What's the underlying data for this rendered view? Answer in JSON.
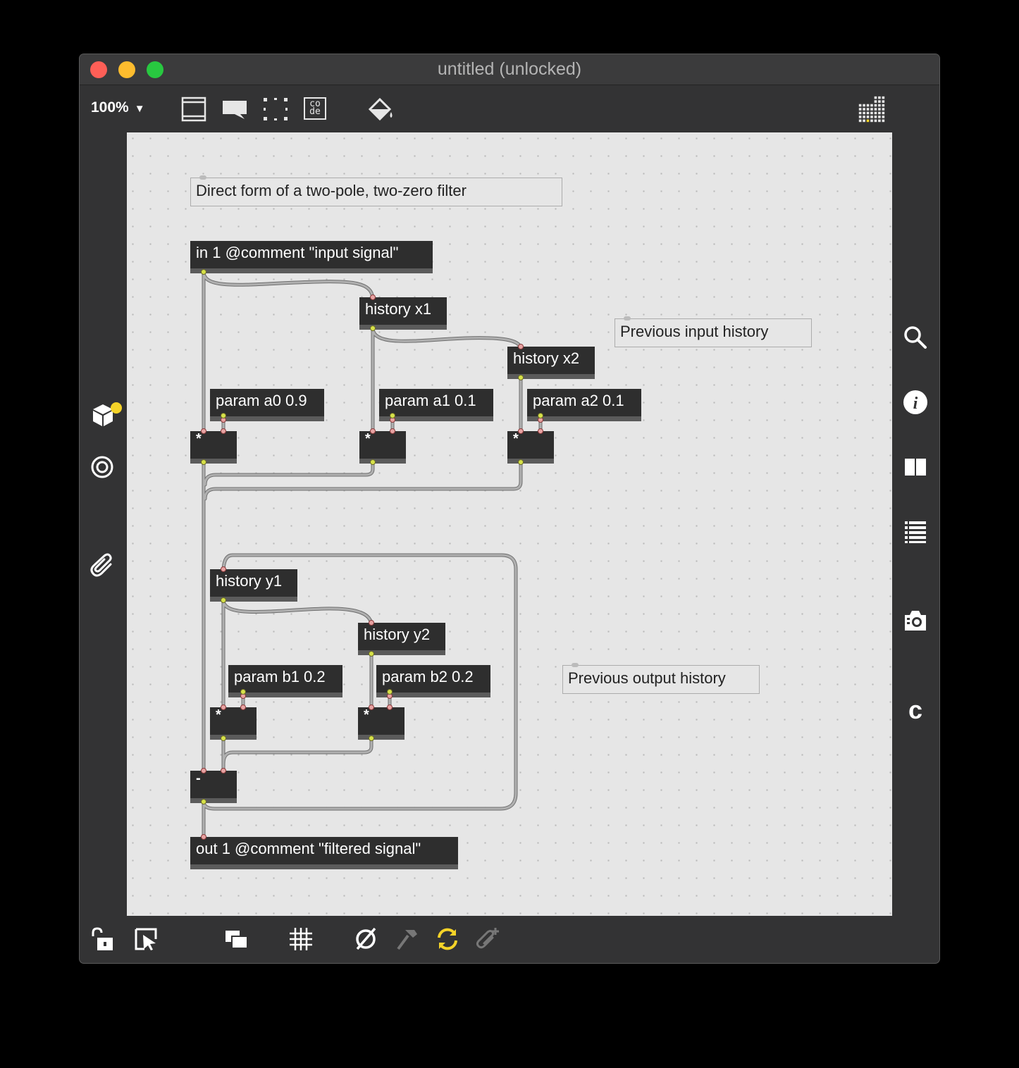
{
  "window": {
    "title": "untitled (unlocked)"
  },
  "toolbar": {
    "zoom_label": "100%",
    "icons": [
      "presentation-icon",
      "comment-icon",
      "object-box-icon",
      "code-icon",
      "paint-bucket-icon",
      "grid-view-icon"
    ],
    "code_icon_text": "co de"
  },
  "left_sidebar": {
    "icons": [
      "package-icon",
      "target-icon",
      "paperclip-icon"
    ]
  },
  "right_sidebar": {
    "icons": [
      "search-icon",
      "info-icon",
      "columns-icon",
      "list-icon",
      "camera-icon",
      "clipping-icon"
    ]
  },
  "bottom_bar": {
    "icons": [
      "lock-icon",
      "presentation-select-icon",
      "layers-icon",
      "grid-icon",
      "mute-icon",
      "hammer-icon",
      "refresh-icon",
      "add-clip-icon"
    ]
  },
  "patch": {
    "comments": {
      "title": "Direct form of a two-pole, two-zero filter",
      "input_history": "Previous input history",
      "output_history": "Previous output history"
    },
    "objects": {
      "in1": "in 1 @comment \"input signal\"",
      "history_x1": "history x1",
      "history_x2": "history x2",
      "param_a0": "param a0 0.9",
      "param_a1": "param a1 0.1",
      "param_a2": "param a2 0.1",
      "mul_a0": "*",
      "mul_a1": "*",
      "mul_a2": "*",
      "history_y1": "history y1",
      "history_y2": "history y2",
      "param_b1": "param b1 0.2",
      "param_b2": "param b2 0.2",
      "mul_b1": "*",
      "mul_b2": "*",
      "subtract": "-",
      "out1": "out 1 @comment \"filtered signal\""
    }
  },
  "colors": {
    "traffic_close": "#fe5f57",
    "traffic_min": "#febc2e",
    "traffic_max": "#28c840",
    "refresh_accent": "#f5d328",
    "package_badge": "#f5d328"
  }
}
